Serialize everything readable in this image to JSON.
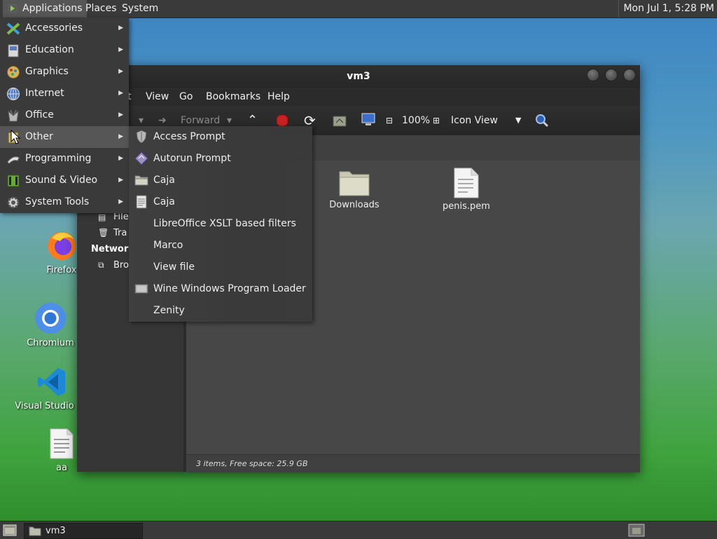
{
  "top_panel": {
    "applications_label": "Applications",
    "places_label": "Places",
    "system_label": "System",
    "clock": "Mon Jul 1, 5:28 PM"
  },
  "desktop_icons": [
    {
      "label": "Firefox",
      "icon": "firefox-icon"
    },
    {
      "label": "Chromium",
      "icon": "chromium-icon"
    },
    {
      "label": "Visual Studio Co",
      "icon": "vscode-icon"
    },
    {
      "label": "aa",
      "icon": "text-file-icon"
    }
  ],
  "window": {
    "title": "vm3",
    "menubar": [
      "t",
      "View",
      "Go",
      "Bookmarks",
      "Help"
    ],
    "toolbar": {
      "forward_label": "Forward",
      "zoom": "100%",
      "view_mode": "Icon View"
    },
    "sidebar": {
      "items": [
        "File",
        "Tra"
      ],
      "network_heading": "Network",
      "network_item": "Bro"
    },
    "files": [
      {
        "name": "Downloads",
        "type": "folder"
      },
      {
        "name": "penis.pem",
        "type": "file"
      }
    ],
    "status": "3 items, Free space: 25.9 GB"
  },
  "app_menu": {
    "items": [
      {
        "label": "Accessories",
        "icon": "accessories-icon"
      },
      {
        "label": "Education",
        "icon": "education-icon"
      },
      {
        "label": "Graphics",
        "icon": "graphics-icon"
      },
      {
        "label": "Internet",
        "icon": "internet-icon"
      },
      {
        "label": "Office",
        "icon": "office-icon"
      },
      {
        "label": "Other",
        "icon": "other-icon"
      },
      {
        "label": "Programming",
        "icon": "programming-icon"
      },
      {
        "label": "Sound & Video",
        "icon": "sound-video-icon"
      },
      {
        "label": "System Tools",
        "icon": "system-tools-icon"
      }
    ],
    "active_item": "Other"
  },
  "other_submenu": {
    "items": [
      {
        "label": "Access Prompt",
        "icon": "shield-icon"
      },
      {
        "label": "Autorun Prompt",
        "icon": "autorun-icon"
      },
      {
        "label": "Caja",
        "icon": "folder-icon"
      },
      {
        "label": "Caja",
        "icon": "caja-document-icon"
      },
      {
        "label": "LibreOffice XSLT based filters",
        "icon": ""
      },
      {
        "label": "Marco",
        "icon": ""
      },
      {
        "label": "View file",
        "icon": ""
      },
      {
        "label": "Wine Windows Program Loader",
        "icon": "wine-icon"
      },
      {
        "label": "Zenity",
        "icon": ""
      }
    ]
  },
  "bottom_panel": {
    "task_label": "vm3"
  },
  "colors": {
    "panel_bg": "#3a3a3a",
    "menu_highlight": "#565656",
    "window_content_bg": "#474747"
  }
}
